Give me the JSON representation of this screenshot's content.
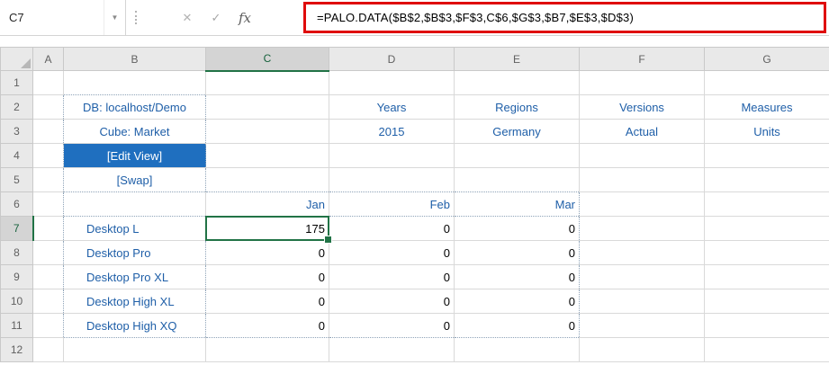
{
  "formula_bar": {
    "name_box": "C7",
    "formula": "=PALO.DATA($B$2,$B$3,$F$3,C$6,$G$3,$B7,$E$3,$D$3)",
    "icons": {
      "dropdown": "▼",
      "cancel": "✕",
      "enter": "✓",
      "fx": "fx"
    }
  },
  "grid": {
    "column_headers": [
      "A",
      "B",
      "C",
      "D",
      "E",
      "F",
      "G"
    ],
    "row_headers": [
      "1",
      "2",
      "3",
      "4",
      "5",
      "6",
      "7",
      "8",
      "9",
      "10",
      "11",
      "12"
    ],
    "selected_cell": "C7",
    "cells": {
      "B2": "DB: localhost/Demo",
      "B3": "Cube: Market",
      "B4": "[Edit View]",
      "B5": "[Swap]",
      "D2": "Years",
      "D3": "2015",
      "E2": "Regions",
      "E3": "Germany",
      "F2": "Versions",
      "F3": "Actual",
      "G2": "Measures",
      "G3": "Units",
      "C6": "Jan",
      "D6": "Feb",
      "E6": "Mar",
      "B7": "Desktop L",
      "C7": "175",
      "D7": "0",
      "E7": "0",
      "B8": "Desktop Pro",
      "C8": "0",
      "D8": "0",
      "E8": "0",
      "B9": "Desktop Pro XL",
      "C9": "0",
      "D9": "0",
      "E9": "0",
      "B10": "Desktop High XL",
      "C10": "0",
      "D10": "0",
      "E10": "0",
      "B11": "Desktop High XQ",
      "C11": "0",
      "D11": "0",
      "E11": "0"
    }
  },
  "colors": {
    "link_blue": "#1f5fa8",
    "selection_green": "#217346",
    "edit_view_blue": "#1f6fbf",
    "highlight_red": "#df0b0b"
  }
}
